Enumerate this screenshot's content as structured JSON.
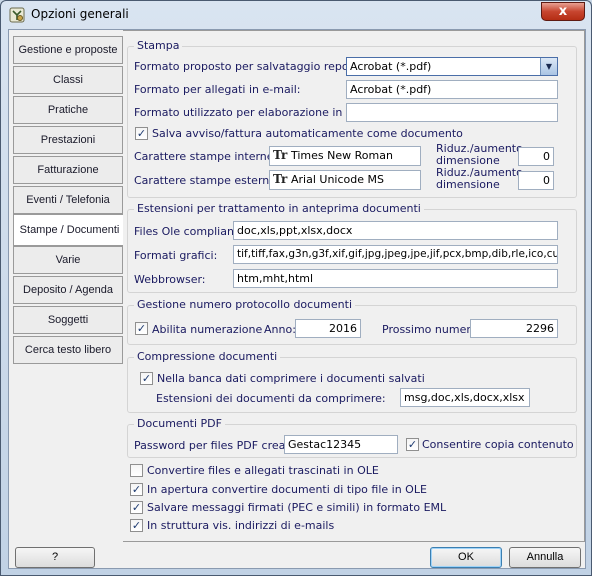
{
  "window": {
    "title": "Opzioni generali",
    "close_symbol": "x"
  },
  "tabs": [
    {
      "label": "Gestione e proposte"
    },
    {
      "label": "Classi"
    },
    {
      "label": "Pratiche"
    },
    {
      "label": "Prestazioni"
    },
    {
      "label": "Fatturazione"
    },
    {
      "label": "Eventi / Telefonia"
    },
    {
      "label": "Stampe / Documenti"
    },
    {
      "label": "Varie"
    },
    {
      "label": "Deposito / Agenda"
    },
    {
      "label": "Soggetti"
    },
    {
      "label": "Cerca testo libero"
    }
  ],
  "active_tab": "Stampe / Documenti",
  "stampa": {
    "title": "Stampa",
    "formato_salvataggio_label": "Formato proposto per salvataggio report:",
    "formato_salvataggio_value": "Acrobat (*.pdf)",
    "formato_email_label": "Formato per allegati in e-mail:",
    "formato_email_value": "Acrobat (*.pdf)",
    "formato_word_label": "Formato utilizzato per elaborazione in word:",
    "formato_word_value": "",
    "salva_avviso_label": "Salva avviso/fattura automaticamente come documento",
    "salva_avviso_checked": true,
    "car_interne_label": "Carattere stampe interne:",
    "car_interne_value": "Times New Roman",
    "car_esterne_label": "Carattere stampe esterne:",
    "car_esterne_value": "Arial Unicode MS",
    "riduz_label_1": "Riduz./aumento",
    "riduz_label_2": "dimensione",
    "riduz_interne_value": "0",
    "riduz_esterne_value": "0",
    "font_icon": "Tr"
  },
  "estensioni": {
    "title": "Estensioni per trattamento in anteprima documenti",
    "files_ole_label": "Files Ole compliant:",
    "files_ole_value": "doc,xls,ppt,xlsx,docx",
    "formati_grafici_label": "Formati grafici:",
    "formati_grafici_value": "tif,tiff,fax,g3n,g3f,xif,gif,jpg,jpeg,jpe,jif,pcx,bmp,dib,rle,ico,cur,",
    "webbrowser_label": "Webbrowser:",
    "webbrowser_value": "htm,mht,html"
  },
  "protocollo": {
    "title": "Gestione numero protocollo documenti",
    "abilita_label": "Abilita numerazione",
    "abilita_checked": true,
    "anno_label": "Anno:",
    "anno_value": "2016",
    "prossimo_label": "Prossimo numero:",
    "prossimo_value": "2296"
  },
  "compressione": {
    "title": "Compressione documenti",
    "comprimi_label": "Nella banca dati comprimere i documenti salvati",
    "comprimi_checked": true,
    "estensioni_label": "Estensioni dei documenti da comprimere:",
    "estensioni_value": "msg,doc,xls,docx,xlsx"
  },
  "pdf": {
    "title": "Documenti PDF",
    "password_label": "Password per files PDF creati:",
    "password_value": "Gestac12345",
    "consentire_label": "Consentire copia contenuto",
    "consentire_checked": true
  },
  "options": [
    {
      "label": "Convertire files e allegati trascinati in OLE",
      "checked": false
    },
    {
      "label": "In apertura convertire documenti di tipo file in OLE",
      "checked": true
    },
    {
      "label": "Salvare messaggi firmati (PEC e simili) in formato EML",
      "checked": true
    },
    {
      "label": "In struttura vis. indirizzi di e-mails",
      "checked": true
    }
  ],
  "buttons": {
    "help": "?",
    "ok": "OK",
    "cancel": "Annulla"
  },
  "check_mark": "✓",
  "colors": {
    "title_text": "#000000",
    "label_text": "#1a1a60",
    "close_button": "#c7452f"
  }
}
